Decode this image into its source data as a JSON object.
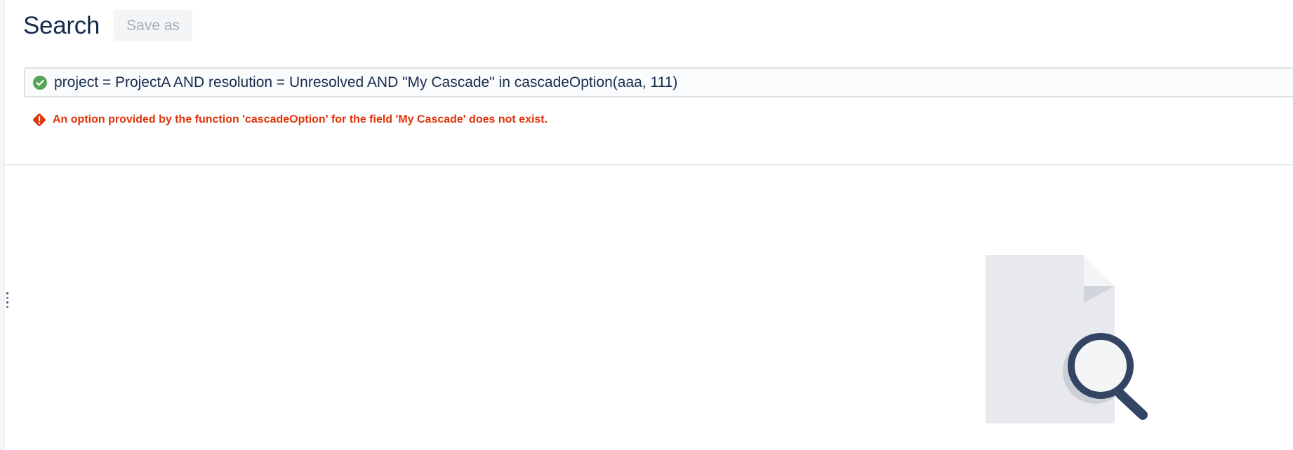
{
  "header": {
    "title": "Search",
    "save_as_label": "Save as"
  },
  "query": {
    "text": "project = ProjectA AND resolution = Unresolved AND \"My Cascade\" in cascadeOption(aaa, 111)",
    "status_icon": "check-circle-icon",
    "status_color": "#57a55a"
  },
  "error": {
    "icon": "error-diamond-icon",
    "message": "An option provided by the function 'cascadeOption' for the field 'My Cascade' does not exist.",
    "color": "#de350b"
  },
  "empty_state": {
    "icon": "document-search-illustration"
  },
  "colors": {
    "title": "#172b4d",
    "disabled_button_bg": "#f4f5f7",
    "disabled_button_text": "#a5adba",
    "query_border": "#dfe1e6",
    "query_bg": "#fafbfc"
  }
}
